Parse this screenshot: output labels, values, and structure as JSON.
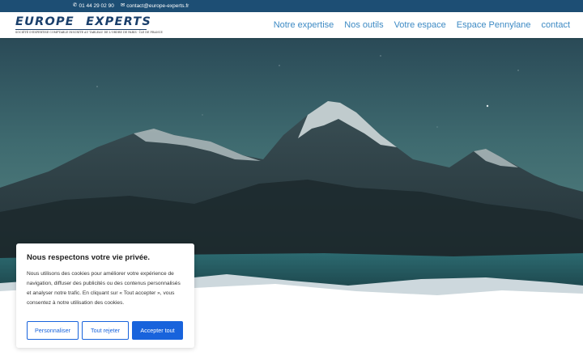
{
  "topbar": {
    "phone": "01 44 29 02 90",
    "email": "contact@europe-experts.fr",
    "phone_icon": "phone-icon",
    "email_icon": "envelope-icon"
  },
  "logo": {
    "title": "EUROPE EXPERTS",
    "subtitle": "SOCIÉTÉ D'EXPERTISE COMPTABLE INSCRITE AU TABLEAU DE L'ORDRE DE PARIS - ÎLE DE FRANCE"
  },
  "nav": {
    "items": [
      {
        "label": "Notre expertise"
      },
      {
        "label": "Nos outils"
      },
      {
        "label": "Votre espace"
      },
      {
        "label": "Espace Pennylane"
      },
      {
        "label": "contact"
      }
    ]
  },
  "cookie": {
    "title": "Nous respectons votre vie privée.",
    "text": "Nous utilisons des cookies pour améliorer votre expérience de navigation, diffuser des publicités ou des contenus personnalisés et analyser notre trafic. En cliquant sur « Tout accepter », vous consentez à notre utilisation des cookies.",
    "customize_label": "Personnaliser",
    "reject_label": "Tout rejeter",
    "accept_label": "Accepter tout"
  },
  "colors": {
    "topbar": "#1d4e74",
    "nav_link": "#3d8ac4",
    "logo": "#1a3f6b",
    "button": "#1863dc"
  }
}
